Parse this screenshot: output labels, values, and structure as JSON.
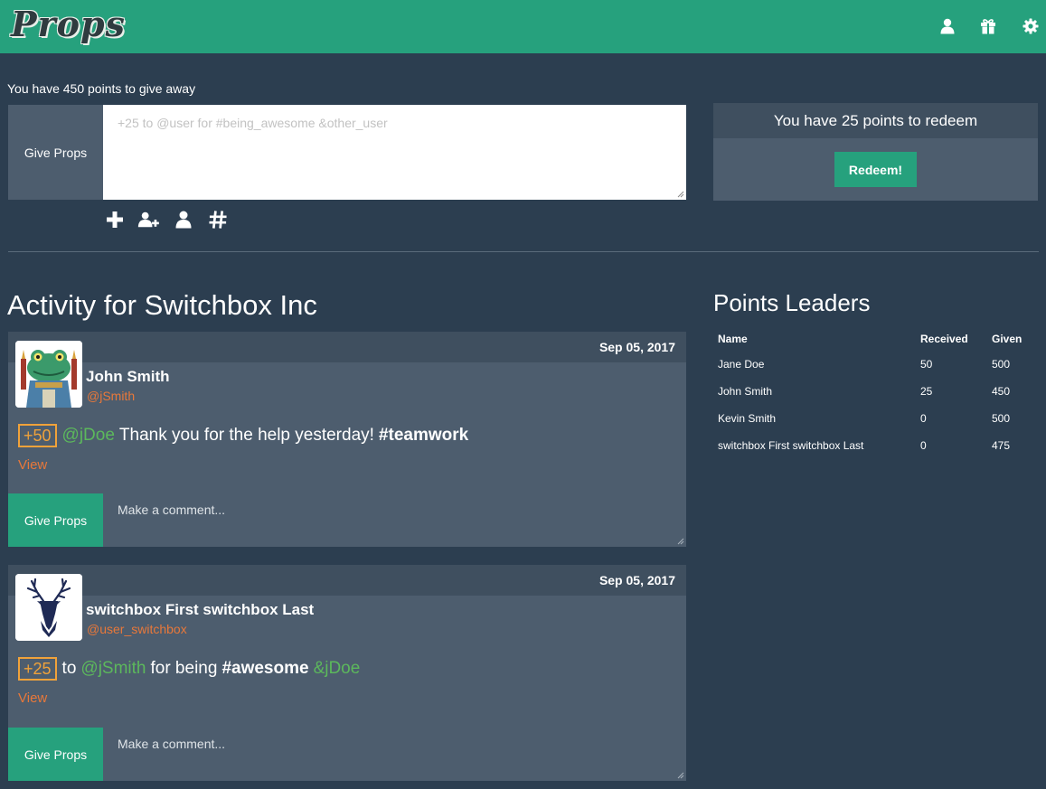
{
  "header": {
    "logo_text": "Props",
    "nav_icons": [
      "user-icon",
      "gift-icon",
      "gear-icon"
    ],
    "brand_color": "#26a17d"
  },
  "give": {
    "points_text": "You have 450 points to give away",
    "label": "Give Props",
    "placeholder": "+25 to @user for #being_awesome &other_user",
    "tools": [
      "plus-icon",
      "add-user-icon",
      "user-icon",
      "hashtag-icon"
    ]
  },
  "redeem": {
    "text": "You have 25 points to redeem",
    "button_label": "Redeem!"
  },
  "activity": {
    "title": "Activity for Switchbox Inc",
    "posts": [
      {
        "date": "Sep 05, 2017",
        "name": "John Smith",
        "handle": "@jSmith",
        "points": "+50",
        "mention": "@jDoe",
        "text": "Thank you for the help yesterday!",
        "hashtag": "#teamwork",
        "view_label": "View",
        "button_label": "Give Props",
        "comment_placeholder": "Make a comment..."
      },
      {
        "date": "Sep 05, 2017",
        "name": "switchbox First switchbox Last",
        "handle": "@user_switchbox",
        "points": "+25",
        "word_to": "to",
        "mention": "@jSmith",
        "text": "for being",
        "hashtag": "#awesome",
        "mention2": "&jDoe",
        "view_label": "View",
        "button_label": "Give Props",
        "comment_placeholder": "Make a comment..."
      }
    ]
  },
  "leaders": {
    "title": "Points Leaders",
    "columns": [
      "Name",
      "Received",
      "Given"
    ],
    "rows": [
      [
        "Jane Doe",
        "50",
        "500"
      ],
      [
        "John Smith",
        "25",
        "450"
      ],
      [
        "Kevin Smith",
        "0",
        "500"
      ],
      [
        "switchbox First switchbox Last",
        "0",
        "475"
      ]
    ]
  }
}
